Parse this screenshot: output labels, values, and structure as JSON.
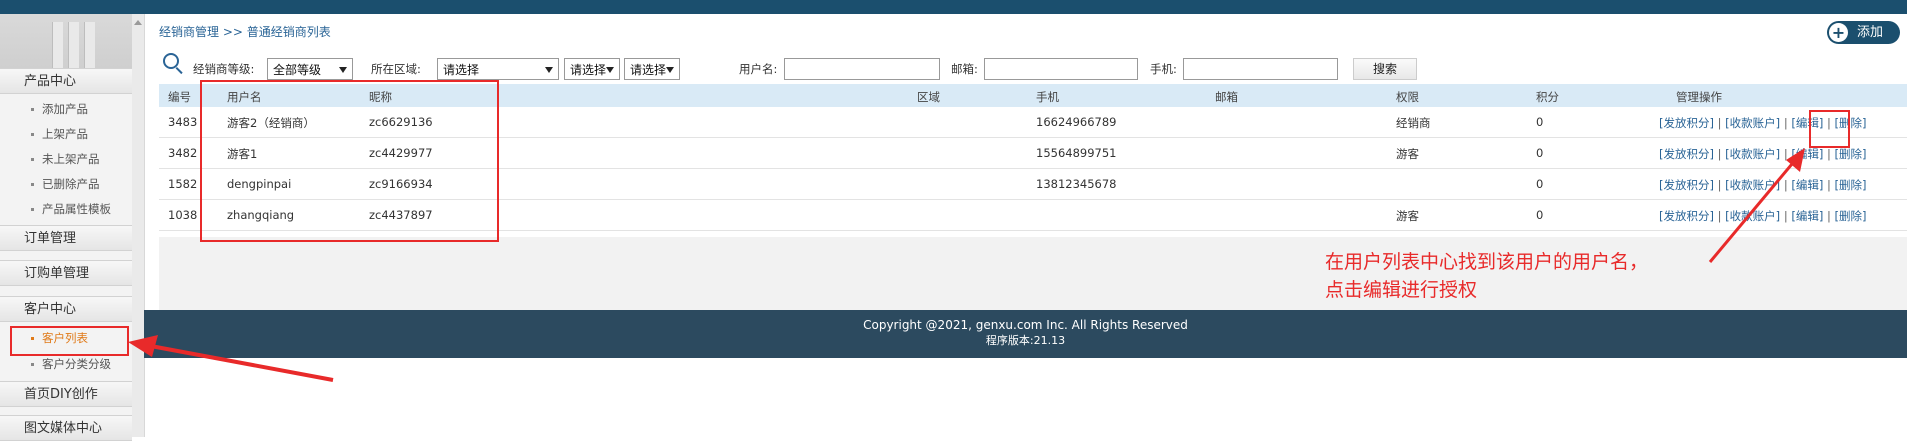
{
  "sidebar": {
    "groups": [
      {
        "label": "产品中心",
        "items": [
          "添加产品",
          "上架产品",
          "未上架产品",
          "已删除产品",
          "产品属性模板"
        ]
      },
      {
        "label": "订单管理"
      },
      {
        "label": "订购单管理"
      },
      {
        "label": "客户中心",
        "items": [
          "客户列表",
          "客户分类分级"
        ],
        "active": "客户列表"
      },
      {
        "label": "首页DIY创作"
      },
      {
        "label": "图文媒体中心"
      }
    ]
  },
  "breadcrumb": "经销商管理 >> 普通经销商列表",
  "add_button": "添加",
  "filter": {
    "level_label": "经销商等级:",
    "level_value": "全部等级",
    "region_label": "所在区域:",
    "region_values": [
      "请选择",
      "请选择",
      "请选择"
    ],
    "username_label": "用户名:",
    "email_label": "邮箱:",
    "phone_label": "手机:",
    "search_button": "搜索"
  },
  "table": {
    "headers": [
      "编号",
      "用户名",
      "昵称",
      "区域",
      "手机",
      "邮箱",
      "权限",
      "积分",
      "管理操作"
    ],
    "rows": [
      {
        "id": "3483",
        "username": "游客2（经销商）",
        "nickname": "zc6629136",
        "region": "",
        "phone": "16624966789",
        "email": "",
        "permission": "经销商",
        "points": "0"
      },
      {
        "id": "3482",
        "username": "游客1",
        "nickname": "zc4429977",
        "region": "",
        "phone": "15564899751",
        "email": "",
        "permission": "游客",
        "points": "0"
      },
      {
        "id": "1582",
        "username": "dengpinpai",
        "nickname": "zc9166934",
        "region": "",
        "phone": "13812345678",
        "email": "",
        "permission": "",
        "points": "0"
      },
      {
        "id": "1038",
        "username": "zhangqiang",
        "nickname": "zc4437897",
        "region": "",
        "phone": "",
        "email": "",
        "permission": "游客",
        "points": "0"
      }
    ],
    "actions": [
      "[发放积分]",
      "[收款账户]",
      "[编辑]",
      "[删除]"
    ],
    "separator": "|"
  },
  "footer": {
    "copyright": "Copyright @2021, genxu.com Inc. All Rights Reserved",
    "version": "程序版本:21.13"
  },
  "annotation": {
    "line1": "在用户列表中心找到该用户的用户名，",
    "line2": "点击编辑进行授权",
    "color": "#e82a2a"
  }
}
